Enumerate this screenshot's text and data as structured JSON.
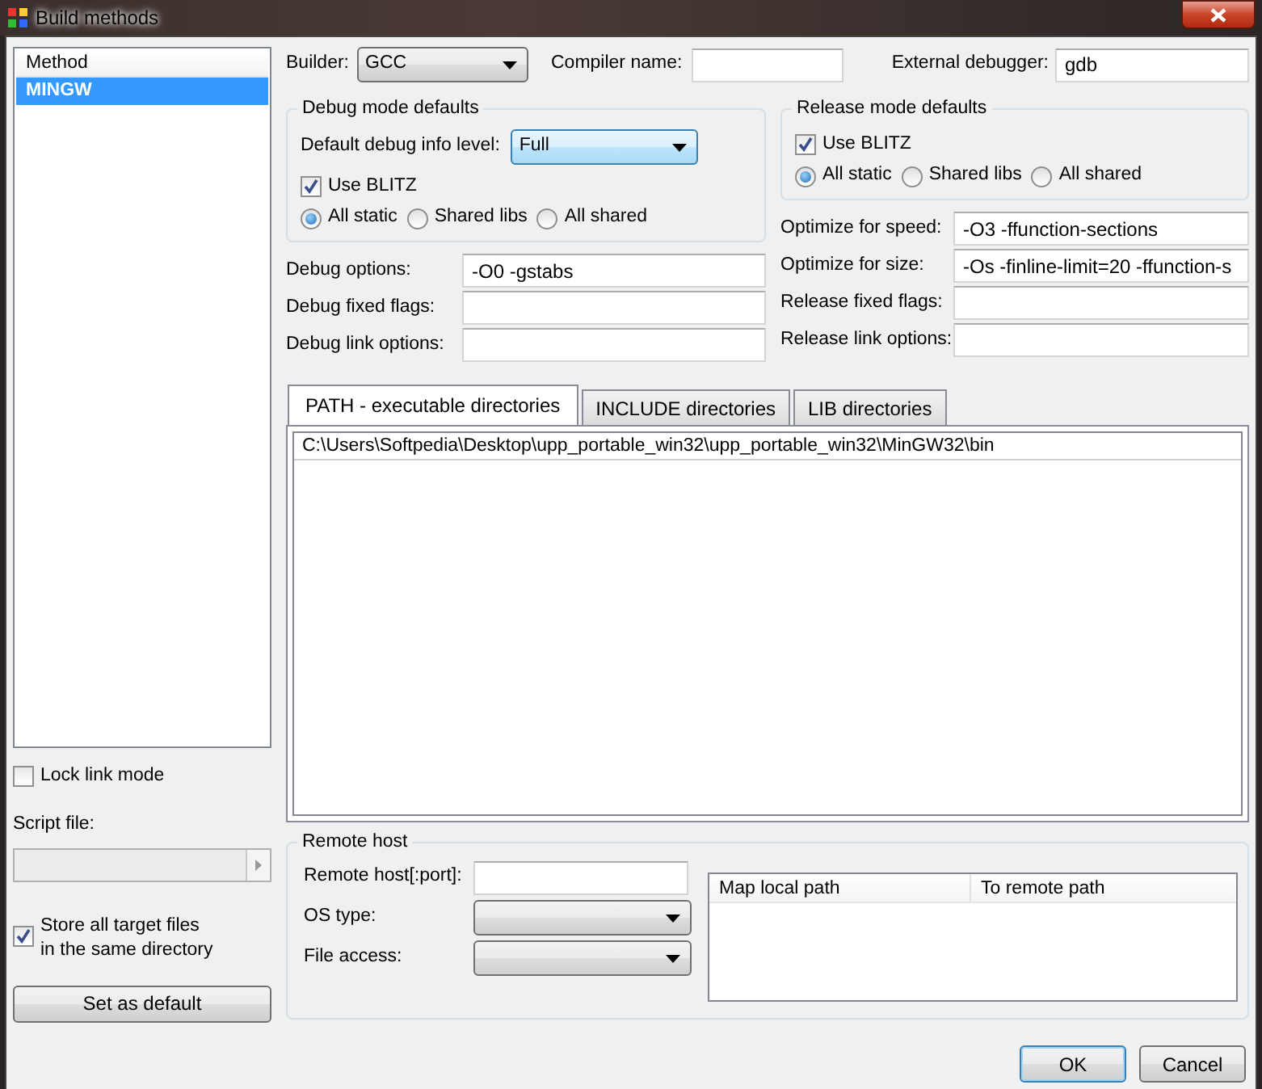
{
  "window": {
    "title": "Build methods"
  },
  "methods": {
    "header": "Method",
    "items": [
      {
        "label": "MINGW",
        "selected": true
      }
    ]
  },
  "lock_link_mode": {
    "label": "Lock link mode",
    "checked": false
  },
  "script_file": {
    "label": "Script file:"
  },
  "store_target": {
    "label_lines": [
      "Store all target files",
      "in the same directory"
    ],
    "checked": true
  },
  "set_default": {
    "label": "Set as default"
  },
  "builder": {
    "label": "Builder:",
    "value": "GCC"
  },
  "compiler_name": {
    "label": "Compiler name:"
  },
  "external_debugger": {
    "label": "External debugger:",
    "value": "gdb"
  },
  "debug_defaults": {
    "title": "Debug mode defaults",
    "info_level": {
      "label": "Default debug info level:",
      "value": "Full"
    },
    "use_blitz": {
      "label": "Use BLITZ",
      "checked": true
    },
    "link_modes": [
      {
        "label": "All static",
        "selected": true
      },
      {
        "label": "Shared libs",
        "selected": false
      },
      {
        "label": "All shared",
        "selected": false
      }
    ]
  },
  "debug_options": [
    {
      "label": "Debug options:",
      "value": "-O0 -gstabs"
    },
    {
      "label": "Debug fixed flags:"
    },
    {
      "label": "Debug link options:"
    }
  ],
  "release_defaults": {
    "title": "Release mode defaults",
    "use_blitz": {
      "label": "Use BLITZ",
      "checked": true
    },
    "link_modes": [
      {
        "label": "All static",
        "selected": true
      },
      {
        "label": "Shared libs",
        "selected": false
      },
      {
        "label": "All shared",
        "selected": false
      }
    ]
  },
  "release_options": [
    {
      "label": "Optimize for speed:",
      "value": "-O3 -ffunction-sections"
    },
    {
      "label": "Optimize for size:",
      "value": "-Os -finline-limit=20 -ffunction-s"
    },
    {
      "label": "Release fixed flags:"
    },
    {
      "label": "Release link options:"
    }
  ],
  "tabs": [
    {
      "label": "PATH - executable directories",
      "selected": true
    },
    {
      "label": "INCLUDE directories",
      "selected": false
    },
    {
      "label": "LIB directories",
      "selected": false
    }
  ],
  "paths": [
    "C:\\Users\\Softpedia\\Desktop\\upp_portable_win32\\upp_portable_win32\\MinGW32\\bin"
  ],
  "remote_host": {
    "title": "Remote host",
    "fields": [
      {
        "label": "Remote host[:port]:",
        "kind": "input"
      },
      {
        "label": "OS type:",
        "kind": "select"
      },
      {
        "label": "File access:",
        "kind": "select"
      }
    ],
    "table": {
      "columns": [
        "Map local path",
        "To remote path"
      ]
    }
  },
  "buttons": [
    {
      "label": "OK",
      "default": true
    },
    {
      "label": "Cancel",
      "default": false
    }
  ]
}
